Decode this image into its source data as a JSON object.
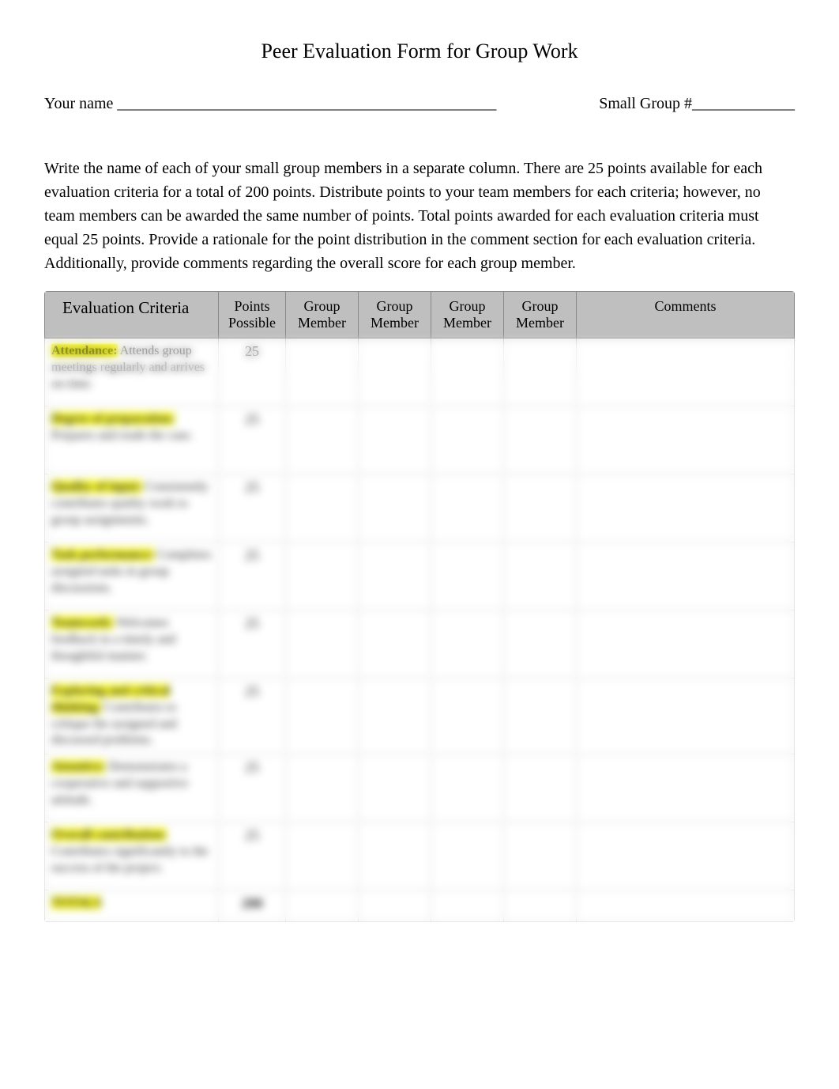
{
  "title": "Peer Evaluation Form for Group Work",
  "name_label": "Your name ________________________________________________",
  "group_label": "Small Group #_____________",
  "instructions": "Write the name of each of your small group members in a separate column. There are 25 points available for each evaluation criteria for a total of 200 points. Distribute points to your team members for each criteria; however, no team members can be awarded the same number of points. Total points awarded for each evaluation criteria must equal 25 points. Provide a rationale for the point distribution in the comment section for each evaluation criteria. Additionally, provide comments regarding the overall score for each group member.",
  "headers": {
    "criteria": "Evaluation Criteria",
    "points": "Points Possible",
    "gm1": "Group Member",
    "gm2": "Group Member",
    "gm3": "Group Member",
    "gm4": "Group Member",
    "comments": "Comments"
  },
  "rows": [
    {
      "label_hl": "Attendance:",
      "label_rest": " Attends group meetings regularly and arrives on time.",
      "points": "25"
    },
    {
      "label_hl": "Degree of preparation:",
      "label_rest": " Prepares and reads the case.",
      "points": "25"
    },
    {
      "label_hl": "Quality of input:",
      "label_rest": " Consistently contributes quality work to group assignments.",
      "points": "25"
    },
    {
      "label_hl": "Task performance:",
      "label_rest": " Completes assigned tasks in group discussions.",
      "points": "25"
    },
    {
      "label_hl": "Teamwork:",
      "label_rest": " Welcomes feedback in a timely and thoughtful manner.",
      "points": "25"
    },
    {
      "label_hl": "Exploring and critical thinking:",
      "label_rest": " Contributes to critique the assigned and discussed problems.",
      "points": "25"
    },
    {
      "label_hl": "Attentive:",
      "label_rest": " Demonstrates a cooperative and supportive attitude.",
      "points": "25"
    },
    {
      "label_hl": "Overall contribution:",
      "label_rest": " Contributes significantly to the success of the project.",
      "points": "25"
    }
  ],
  "totals_label": "TOTALS",
  "totals_points": "200"
}
